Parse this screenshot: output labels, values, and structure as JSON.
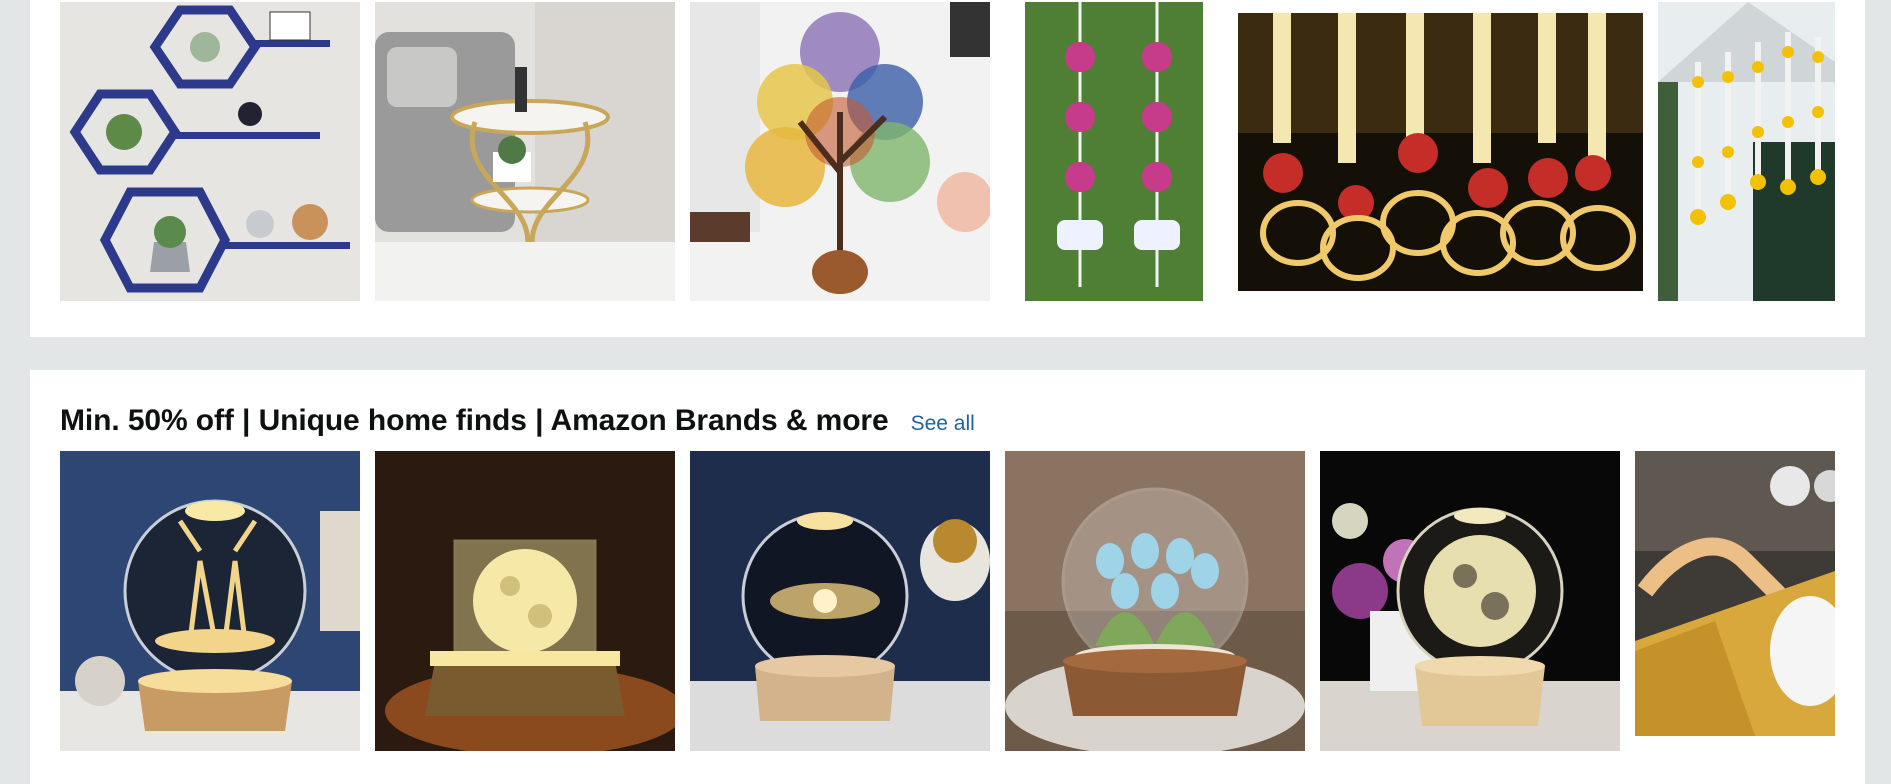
{
  "top_row": {
    "items": [
      {
        "image": "hexagon-wall-shelves",
        "color": "#2d3a8c"
      },
      {
        "image": "gold-side-table",
        "color": "#c8a65a"
      },
      {
        "image": "gemstone-tree",
        "color": "#6b3f22"
      },
      {
        "image": "lotus-wall-hangings",
        "color": "#c63b8a"
      },
      {
        "image": "marigold-tea-light-toran",
        "color": "#f5e7b0"
      },
      {
        "image": "door-flower-garland",
        "color": "#f2c200"
      }
    ]
  },
  "section": {
    "title": "Min. 50% off | Unique home finds | Amazon Brands & more",
    "see_all": "See all",
    "items": [
      {
        "image": "deer-crystal-ball-lamp",
        "color": "#f2d48a"
      },
      {
        "image": "moon-cube-crystal-lamp",
        "color": "#f6e9a8"
      },
      {
        "image": "galaxy-crystal-ball-lamp",
        "color": "#e6c77a"
      },
      {
        "image": "tulip-crystal-ball-lamp",
        "color": "#9fd3e8"
      },
      {
        "image": "moon-crystal-ball-lamp",
        "color": "#e8dfb0"
      },
      {
        "image": "book-clip-reading-lamp",
        "color": "#d9a83d"
      }
    ]
  }
}
